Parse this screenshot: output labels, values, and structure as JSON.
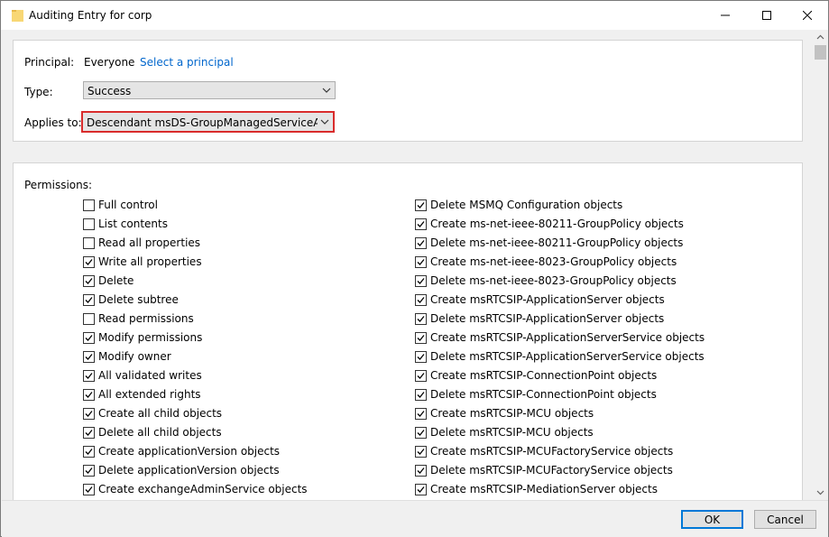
{
  "window": {
    "title": "Auditing Entry for corp"
  },
  "principal": {
    "label": "Principal:",
    "value": "Everyone",
    "link": "Select a principal"
  },
  "type": {
    "label": "Type:",
    "value": "Success"
  },
  "applies_to": {
    "label": "Applies to:",
    "value": "Descendant msDS-GroupManagedServiceAccount objects"
  },
  "permissions": {
    "label": "Permissions:",
    "left": [
      {
        "label": "Full control",
        "checked": false
      },
      {
        "label": "List contents",
        "checked": false
      },
      {
        "label": "Read all properties",
        "checked": false
      },
      {
        "label": "Write all properties",
        "checked": true
      },
      {
        "label": "Delete",
        "checked": true
      },
      {
        "label": "Delete subtree",
        "checked": true
      },
      {
        "label": "Read permissions",
        "checked": false
      },
      {
        "label": "Modify permissions",
        "checked": true
      },
      {
        "label": "Modify owner",
        "checked": true
      },
      {
        "label": "All validated writes",
        "checked": true
      },
      {
        "label": "All extended rights",
        "checked": true
      },
      {
        "label": "Create all child objects",
        "checked": true
      },
      {
        "label": "Delete all child objects",
        "checked": true
      },
      {
        "label": "Create applicationVersion objects",
        "checked": true
      },
      {
        "label": "Delete applicationVersion objects",
        "checked": true
      },
      {
        "label": "Create exchangeAdminService objects",
        "checked": true
      }
    ],
    "right": [
      {
        "label": "Delete MSMQ Configuration objects",
        "checked": true
      },
      {
        "label": "Create ms-net-ieee-80211-GroupPolicy objects",
        "checked": true
      },
      {
        "label": "Delete ms-net-ieee-80211-GroupPolicy objects",
        "checked": true
      },
      {
        "label": "Create ms-net-ieee-8023-GroupPolicy objects",
        "checked": true
      },
      {
        "label": "Delete ms-net-ieee-8023-GroupPolicy objects",
        "checked": true
      },
      {
        "label": "Create msRTCSIP-ApplicationServer objects",
        "checked": true
      },
      {
        "label": "Delete msRTCSIP-ApplicationServer objects",
        "checked": true
      },
      {
        "label": "Create msRTCSIP-ApplicationServerService objects",
        "checked": true
      },
      {
        "label": "Delete msRTCSIP-ApplicationServerService objects",
        "checked": true
      },
      {
        "label": "Create msRTCSIP-ConnectionPoint objects",
        "checked": true
      },
      {
        "label": "Delete msRTCSIP-ConnectionPoint objects",
        "checked": true
      },
      {
        "label": "Create msRTCSIP-MCU objects",
        "checked": true
      },
      {
        "label": "Delete msRTCSIP-MCU objects",
        "checked": true
      },
      {
        "label": "Create msRTCSIP-MCUFactoryService objects",
        "checked": true
      },
      {
        "label": "Delete msRTCSIP-MCUFactoryService objects",
        "checked": true
      },
      {
        "label": "Create msRTCSIP-MediationServer objects",
        "checked": true
      }
    ]
  },
  "buttons": {
    "ok": "OK",
    "cancel": "Cancel"
  },
  "icons": {
    "title": "folder-icon",
    "minimize": "minimize-icon",
    "maximize": "maximize-icon",
    "close": "close-icon"
  },
  "colors": {
    "link": "#0066cc",
    "highlight_border": "#d92c2c",
    "default_button_border": "#0078d7"
  }
}
